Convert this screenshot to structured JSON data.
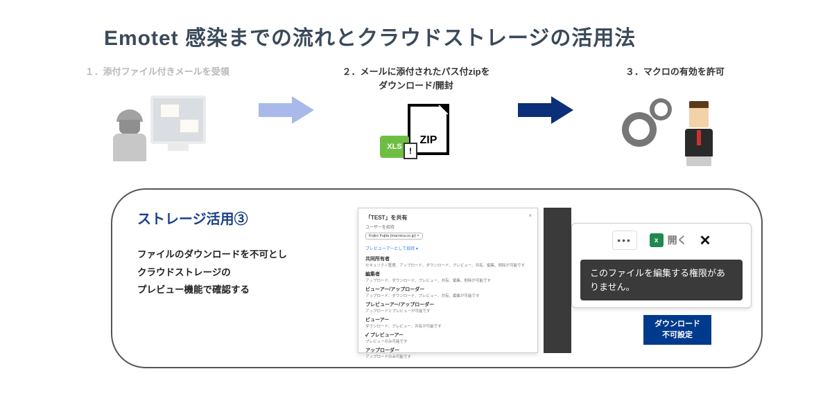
{
  "title": "Emotet 感染までの流れとクラウドストレージの活用法",
  "steps": {
    "s1": "１．添付ファイル付きメールを受領",
    "s2_l1": "２．メールに添付されたパス付zipを",
    "s2_l2": "ダウンロード/開封",
    "s3": "３．マクロの有効を許可"
  },
  "zip_label": "ZIP",
  "xls_label": "XLS",
  "warn_label": "!",
  "callout": {
    "title": "ストレージ活用③",
    "desc_l1": "ファイルのダウンロードを不可とし",
    "desc_l2": "クラウドストレージの",
    "desc_l3": "プレビュー機能で確認する"
  },
  "share": {
    "title": "「TEST」を共有",
    "sub": "ユーザーを招待",
    "chip": "Kojiro Fujita (macnica.co.jp) ×",
    "link": "プレビューアーとして招待 ▾",
    "r1": "共同所有者",
    "r1s": "セキュリティ管理、アップロード、ダウンロード、プレビュー、共有、編集、削除が可能です",
    "r2": "編集者",
    "r2s": "アップロード、ダウンロード、プレビュー、共有、編集、削除が可能です",
    "r3": "ビューアー/アップローダー",
    "r3s": "アップロード、ダウンロード、プレビュー、共有、編集が可能です",
    "r4": "プレビューアー/アップローダー",
    "r4s": "アップロードとプレビューが可能です",
    "r5": "ビューアー",
    "r5s": "ダウンロード、プレビュー、共有が可能です",
    "r6": "プレビューアー",
    "r6s": "プレビューのみ可能です",
    "r7": "アップローダー",
    "r7s": "アップロードのみ可能です",
    "close": "×"
  },
  "pop": {
    "dots": "•••",
    "open": "開く",
    "excel": "x",
    "x": "✕",
    "tooltip": "このファイルを編集する権限がありません。"
  },
  "dl_badge_l1": "ダウンロード",
  "dl_badge_l2": "不可設定"
}
